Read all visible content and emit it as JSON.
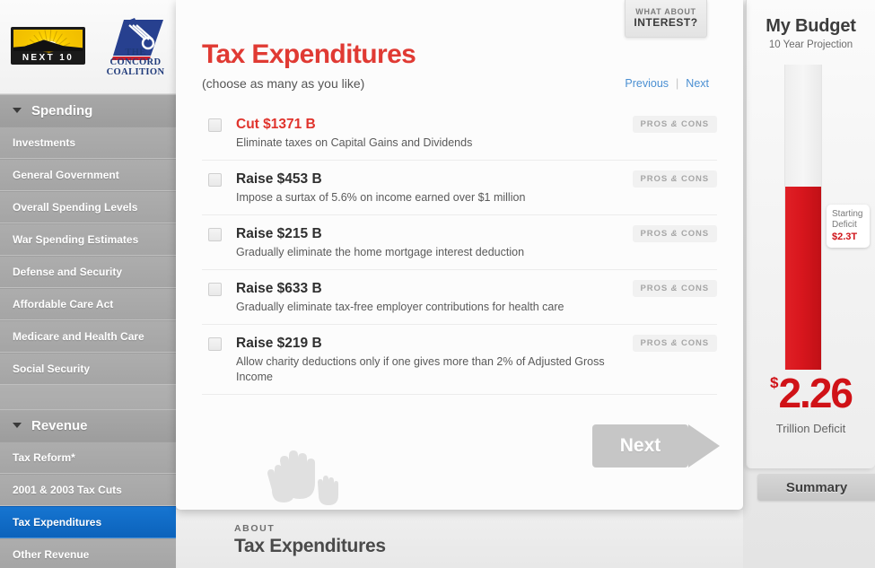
{
  "sidebar": {
    "logos": {
      "next10": "NEXT 10",
      "concord_line1": "THE CONCORD",
      "concord_line2": "COALITION"
    },
    "sections": [
      {
        "title": "Spending",
        "items": [
          {
            "label": "Investments",
            "active": false
          },
          {
            "label": "General Government",
            "active": false
          },
          {
            "label": "Overall Spending Levels",
            "active": false
          },
          {
            "label": "War Spending Estimates",
            "active": false
          },
          {
            "label": "Defense and Security",
            "active": false
          },
          {
            "label": "Affordable Care Act",
            "active": false
          },
          {
            "label": "Medicare and Health Care",
            "active": false
          },
          {
            "label": "Social Security",
            "active": false
          }
        ]
      },
      {
        "title": "Revenue",
        "items": [
          {
            "label": "Tax Reform*",
            "active": false
          },
          {
            "label": "2001 & 2003 Tax Cuts",
            "active": false
          },
          {
            "label": "Tax Expenditures",
            "active": true
          },
          {
            "label": "Other Revenue",
            "active": false
          }
        ]
      }
    ]
  },
  "modal": {
    "interest_tab": {
      "line1": "WHAT ABOUT",
      "line2": "INTEREST?"
    },
    "title": "Tax Expenditures",
    "subtitle": "(choose as many as you like)",
    "pager": {
      "previous": "Previous",
      "separator": "|",
      "next": "Next"
    },
    "pros_cons_label": "PROS",
    "pros_cons_amp": "&",
    "pros_cons_label2": "CONS",
    "options": [
      {
        "amount": "Cut $1371 B",
        "direction": "cut",
        "description": "Eliminate taxes on Capital Gains and Dividends",
        "checked": false
      },
      {
        "amount": "Raise $453 B",
        "direction": "raise",
        "description": "Impose a surtax of 5.6% on income earned over $1 million",
        "checked": false
      },
      {
        "amount": "Raise $215 B",
        "direction": "raise",
        "description": "Gradually eliminate the home mortgage interest deduction",
        "checked": false
      },
      {
        "amount": "Raise $633 B",
        "direction": "raise",
        "description": "Gradually eliminate tax-free employer contributions for health care",
        "checked": false
      },
      {
        "amount": "Raise $219 B",
        "direction": "raise",
        "description": "Allow charity deductions only if one gives more than 2% of Adjusted Gross Income",
        "checked": false
      }
    ],
    "next_button": "Next"
  },
  "about": {
    "kicker": "ABOUT",
    "title": "Tax Expenditures"
  },
  "budget": {
    "title": "My Budget",
    "subtitle": "10 Year Projection",
    "callout": {
      "line1": "Starting",
      "line2": "Deficit",
      "value": "$2.3T"
    },
    "total": {
      "dollar_sign": "$",
      "amount": "2.26",
      "label": "Trillion Deficit"
    },
    "summary_button": "Summary",
    "colors": {
      "deficit_red": "#d01217",
      "accent_blue": "#0b62bb"
    }
  }
}
